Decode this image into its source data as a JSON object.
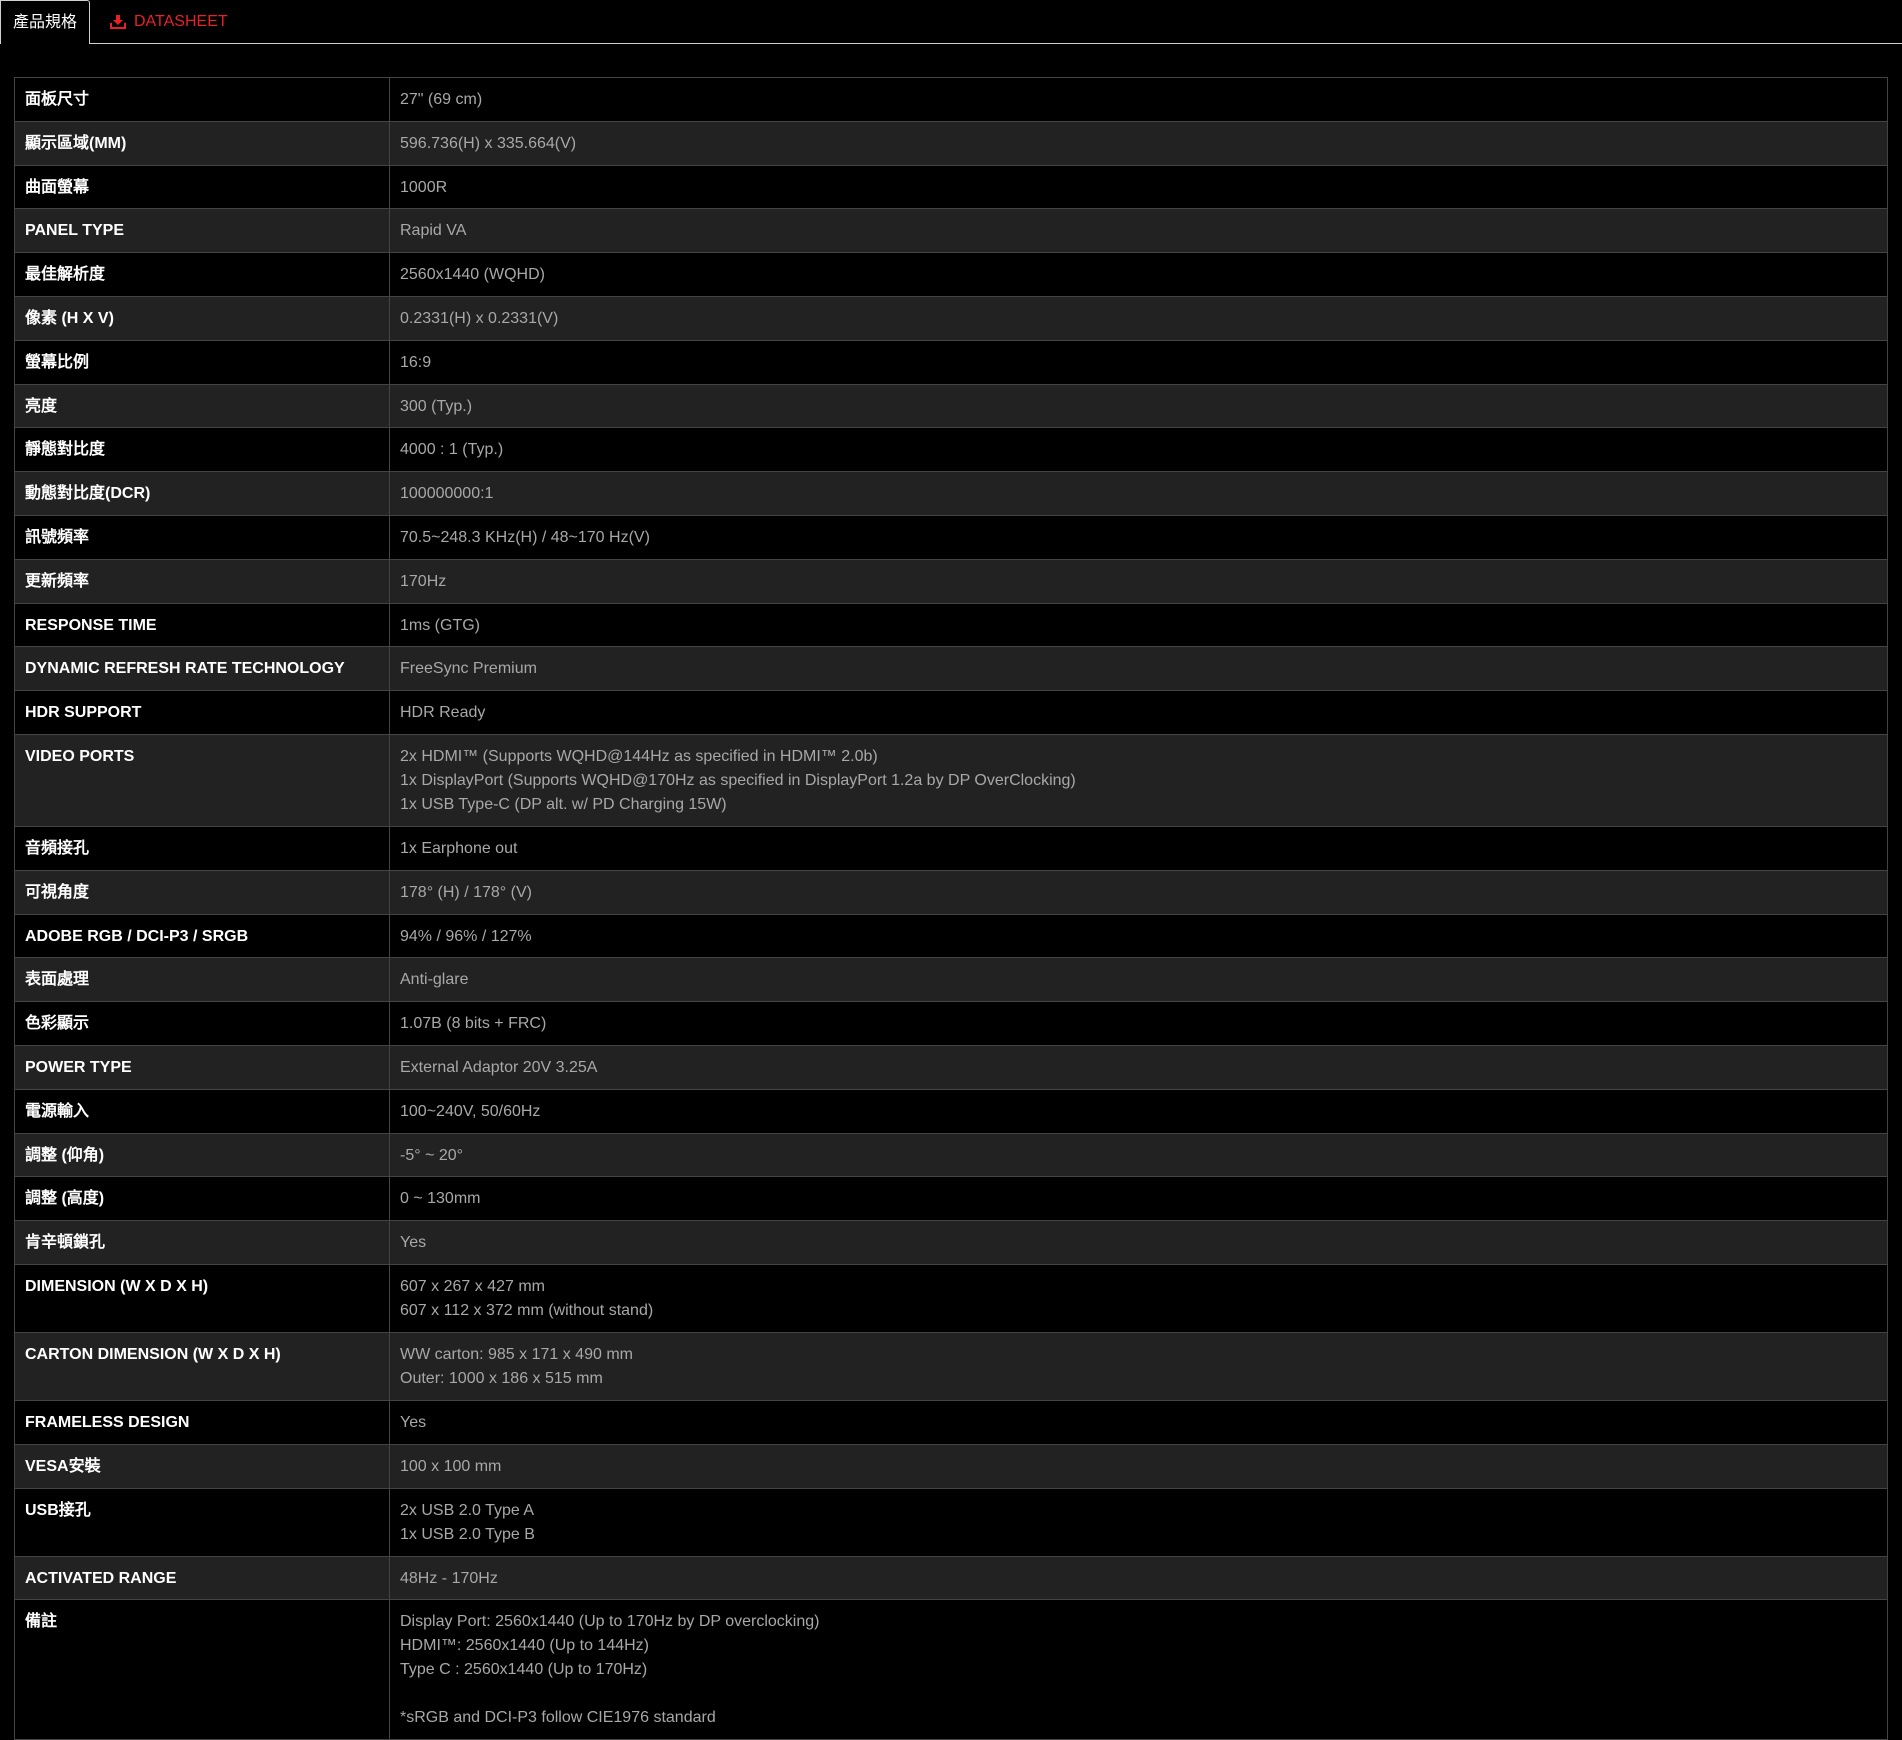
{
  "tabs": {
    "active_label": "產品規格",
    "datasheet_label": "DATASHEET",
    "accent_color": "#e8202a"
  },
  "specs": [
    {
      "label": "面板尺寸",
      "lines": [
        "27\" (69 cm)"
      ]
    },
    {
      "label": "顯示區域(MM)",
      "lines": [
        "596.736(H) x 335.664(V)"
      ]
    },
    {
      "label": "曲面螢幕",
      "lines": [
        "1000R"
      ]
    },
    {
      "label": "PANEL TYPE",
      "lines": [
        "Rapid VA"
      ]
    },
    {
      "label": "最佳解析度",
      "lines": [
        "2560x1440 (WQHD)"
      ]
    },
    {
      "label": "像素 (H X V)",
      "lines": [
        "0.2331(H) x 0.2331(V)"
      ]
    },
    {
      "label": "螢幕比例",
      "lines": [
        "16:9"
      ]
    },
    {
      "label": "亮度",
      "lines": [
        "300 (Typ.)"
      ]
    },
    {
      "label": "靜態對比度",
      "lines": [
        "4000 : 1 (Typ.)"
      ]
    },
    {
      "label": "動態對比度(DCR)",
      "lines": [
        "100000000:1"
      ]
    },
    {
      "label": "訊號頻率",
      "lines": [
        "70.5~248.3 KHz(H) / 48~170 Hz(V)"
      ]
    },
    {
      "label": "更新頻率",
      "lines": [
        "170Hz"
      ]
    },
    {
      "label": "RESPONSE TIME",
      "lines": [
        "1ms (GTG)"
      ]
    },
    {
      "label": "DYNAMIC REFRESH RATE TECHNOLOGY",
      "lines": [
        "FreeSync Premium"
      ]
    },
    {
      "label": "HDR SUPPORT",
      "lines": [
        "HDR Ready"
      ]
    },
    {
      "label": "VIDEO PORTS",
      "lines": [
        "2x HDMI™ (Supports WQHD@144Hz as specified in HDMI™ 2.0b)",
        "1x DisplayPort (Supports WQHD@170Hz as specified in DisplayPort 1.2a by DP OverClocking)",
        "1x USB Type-C (DP alt. w/ PD Charging 15W)"
      ]
    },
    {
      "label": "音頻接孔",
      "lines": [
        "1x Earphone out"
      ]
    },
    {
      "label": "可視角度",
      "lines": [
        "178° (H) / 178° (V)"
      ]
    },
    {
      "label": "ADOBE RGB / DCI-P3 / SRGB",
      "lines": [
        "94% / 96% / 127%"
      ]
    },
    {
      "label": "表面處理",
      "lines": [
        "Anti-glare"
      ]
    },
    {
      "label": "色彩顯示",
      "lines": [
        "1.07B (8 bits + FRC)"
      ]
    },
    {
      "label": "POWER TYPE",
      "lines": [
        "External Adaptor 20V 3.25A"
      ]
    },
    {
      "label": "電源輸入",
      "lines": [
        "100~240V, 50/60Hz"
      ]
    },
    {
      "label": "調整 (仰角)",
      "lines": [
        "-5° ~ 20°"
      ]
    },
    {
      "label": "調整 (高度)",
      "lines": [
        "0 ~ 130mm"
      ]
    },
    {
      "label": "肯辛頓鎖孔",
      "lines": [
        "Yes"
      ]
    },
    {
      "label": "DIMENSION (W X D X H)",
      "lines": [
        "607 x 267 x 427 mm",
        "607 x 112 x 372 mm (without stand)"
      ]
    },
    {
      "label": "CARTON DIMENSION (W X D X H)",
      "lines": [
        "WW carton: 985 x 171 x 490 mm",
        "Outer: 1000 x 186 x 515 mm"
      ]
    },
    {
      "label": "FRAMELESS DESIGN",
      "lines": [
        "Yes"
      ]
    },
    {
      "label": "VESA安裝",
      "lines": [
        "100 x 100 mm"
      ]
    },
    {
      "label": "USB接孔",
      "lines": [
        "2x USB 2.0 Type A",
        "1x USB 2.0 Type B"
      ]
    },
    {
      "label": "ACTIVATED RANGE",
      "lines": [
        "48Hz - 170Hz"
      ]
    },
    {
      "label": "備註",
      "lines": [
        "Display Port: 2560x1440 (Up to 170Hz by DP overclocking)",
        "HDMI™: 2560x1440 (Up to 144Hz)",
        "Type C : 2560x1440 (Up to 170Hz)",
        "",
        "*sRGB and DCI-P3 follow CIE1976 standard"
      ]
    }
  ]
}
